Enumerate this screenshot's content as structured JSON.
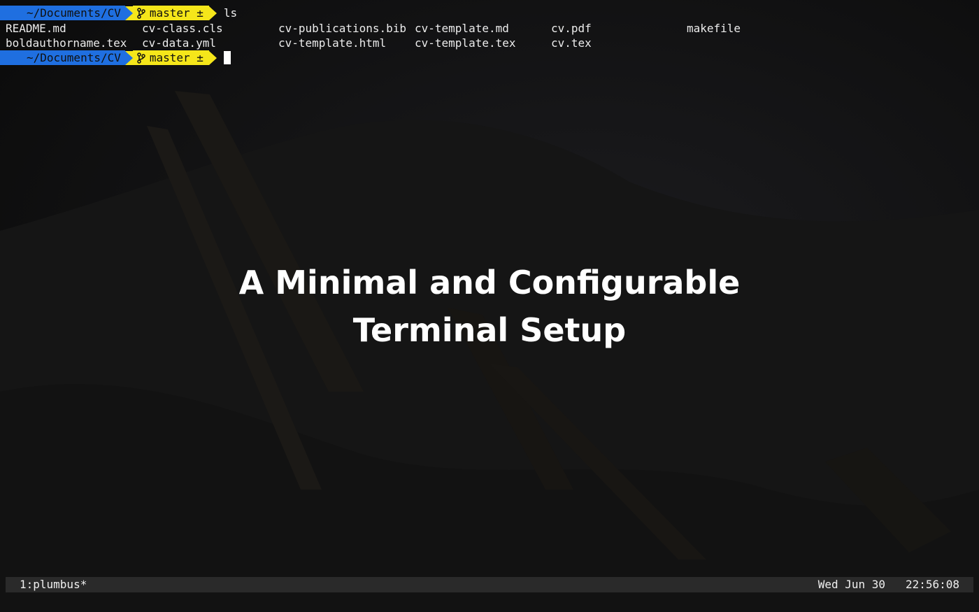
{
  "prompt": {
    "directory": "~/Documents/CV",
    "branch_label": "master ±"
  },
  "command": "ls",
  "ls_output": {
    "row1": [
      "README.md",
      "cv-class.cls",
      "cv-publications.bib",
      "cv-template.md",
      "cv.pdf",
      "makefile"
    ],
    "row2": [
      "boldauthorname.tex",
      "cv-data.yml",
      "cv-template.html",
      "cv-template.tex",
      "cv.tex"
    ]
  },
  "overlay_title": {
    "line1": "A Minimal and Configurable",
    "line2": "Terminal Setup"
  },
  "statusbar": {
    "window": "1:plumbus*",
    "date": "Wed Jun 30",
    "time": "22:56:08"
  },
  "colors": {
    "dir_segment": "#1f6fe0",
    "git_segment": "#f5e61a",
    "background": "#101010"
  },
  "icons": {
    "git_branch": "git-branch-icon"
  }
}
